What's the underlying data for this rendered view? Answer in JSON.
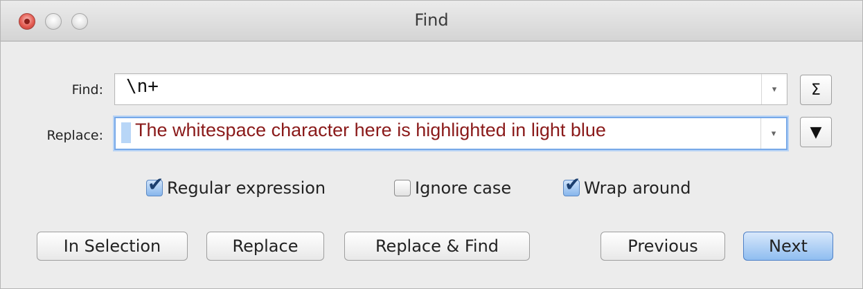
{
  "window": {
    "title": "Find",
    "buttons": [
      "close",
      "minimize",
      "zoom"
    ]
  },
  "find": {
    "label": "Find:",
    "value": "\\n+",
    "side_button": "Σ",
    "side_button_icon": "sigma-icon"
  },
  "replace": {
    "label": "Replace:",
    "value": "The whitespace character here is highlighted in light blue",
    "side_button": "▼",
    "side_button_icon": "triangle-down-icon"
  },
  "options": [
    {
      "label": "Regular expression",
      "checked": true
    },
    {
      "label": "Ignore case",
      "checked": false
    },
    {
      "label": "Wrap around",
      "checked": true
    }
  ],
  "buttons": {
    "in_selection": "In Selection",
    "replace": "Replace",
    "replace_find": "Replace & Find",
    "previous": "Previous",
    "next": "Next"
  },
  "dropdown_glyph": "▾",
  "checkmark_glyph": "✔",
  "colors": {
    "replace_text": "#8a1a1a",
    "whitespace_highlight": "#b8d6f7",
    "default_button": "#8fbdf0",
    "focus_ring": "#77a8e8"
  }
}
